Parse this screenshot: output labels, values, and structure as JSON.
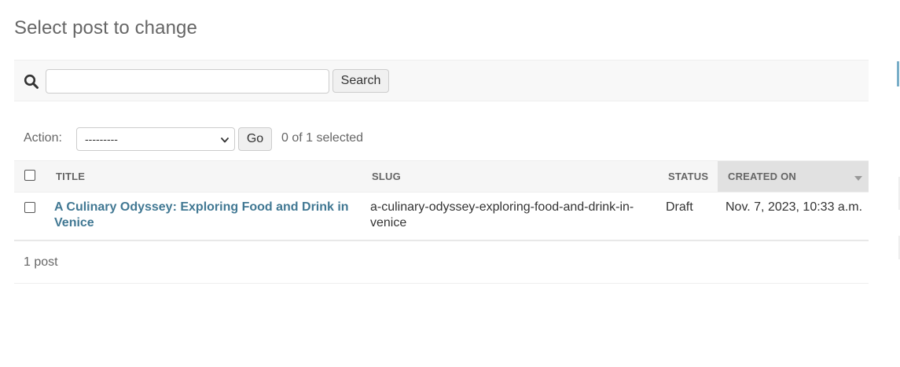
{
  "page": {
    "title": "Select post to change"
  },
  "search": {
    "value": "",
    "placeholder": "",
    "button_label": "Search"
  },
  "actions": {
    "label": "Action:",
    "selected": "---------",
    "go_label": "Go",
    "counter": "0 of 1 selected"
  },
  "table": {
    "columns": [
      {
        "label": "TITLE"
      },
      {
        "label": "SLUG"
      },
      {
        "label": "STATUS"
      },
      {
        "label": "CREATED ON",
        "sorted": true
      }
    ],
    "rows": [
      {
        "title": "A Culinary Odyssey: Exploring Food and Drink in Venice",
        "slug": "a-culinary-odyssey-exploring-food-and-drink-in-venice",
        "status": "Draft",
        "created_on": "Nov. 7, 2023, 10:33 a.m."
      }
    ]
  },
  "paginator": {
    "text": "1 post"
  },
  "colors": {
    "link": "#417893",
    "header_bg": "#f6f6f6",
    "sorted_header_bg": "#e1e1e1",
    "accent": "#79aec8"
  },
  "icons": [
    "search-icon",
    "chevron-down-icon",
    "sort-desc-icon"
  ]
}
